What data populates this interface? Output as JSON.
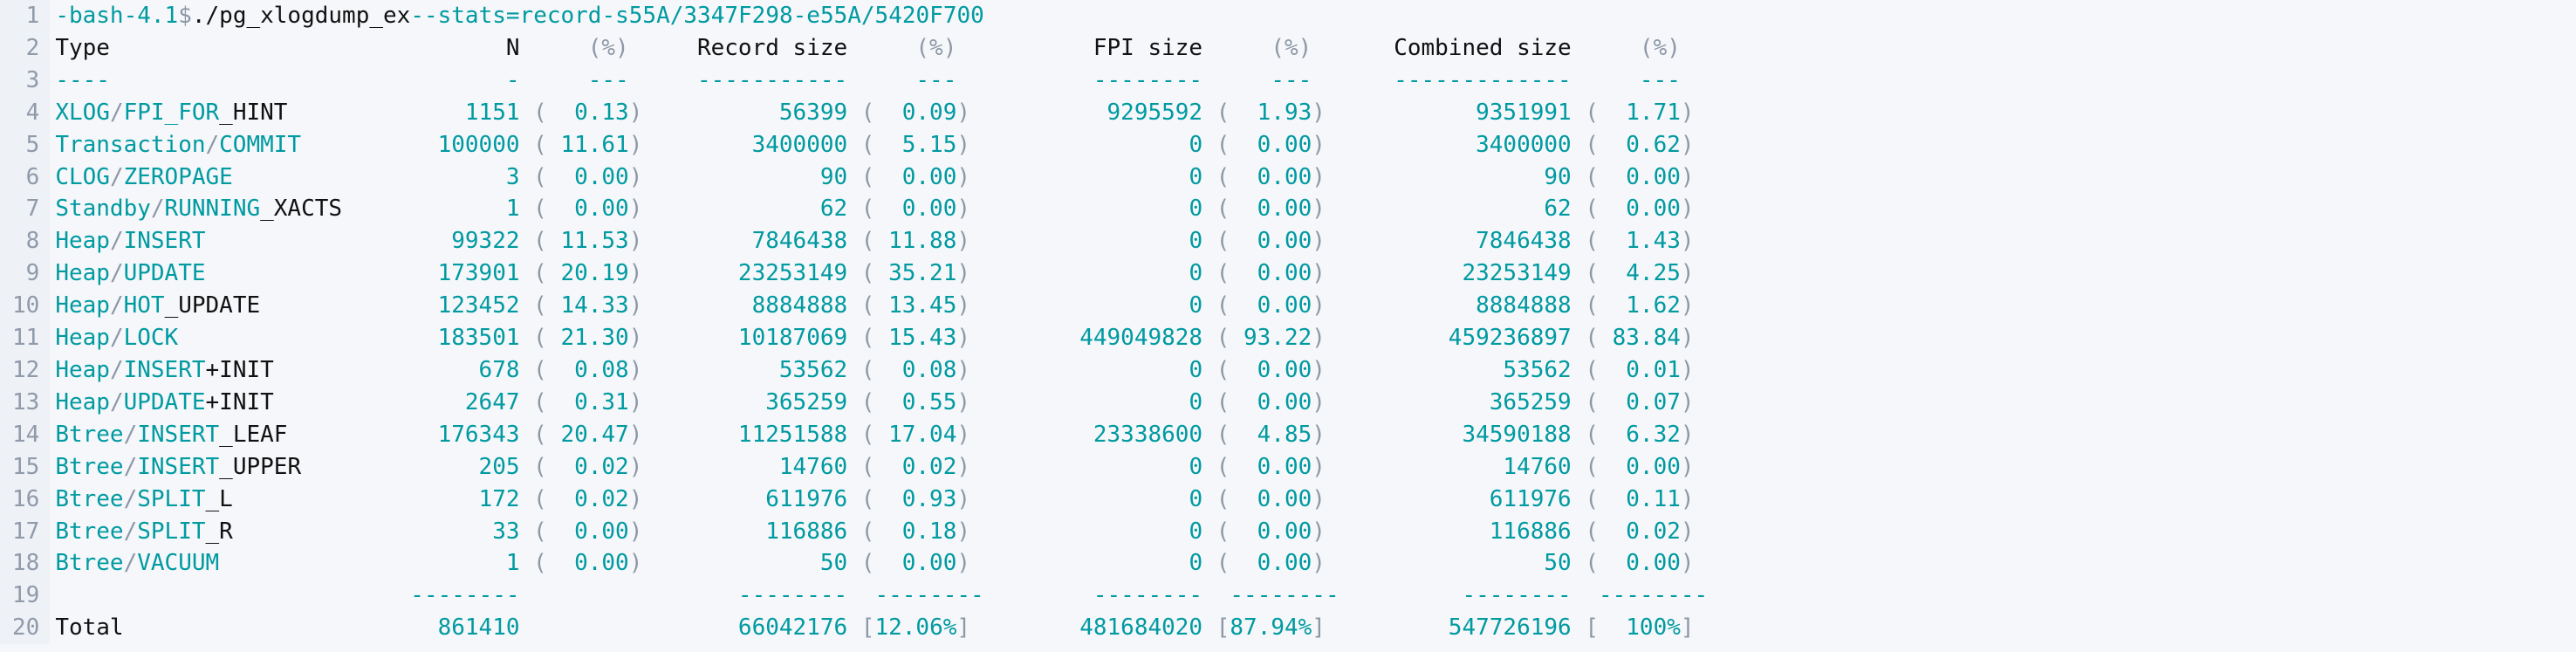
{
  "prompt": {
    "pre": "-bash-4.1",
    "dollar": "$ ",
    "cmd": "./pg_xlogdump_ex",
    "argStats": " --stats=record",
    "flagS": " -s ",
    "valS": "55A/3347F298",
    "flagE": " -e ",
    "valE": "55A/5420F700"
  },
  "head": {
    "type": "Type",
    "n": "N",
    "pct": "(%)",
    "rs": "Record size",
    "fs": "FPI size",
    "cs": "Combined size"
  },
  "dash": {
    "type": "----",
    "n": "        -",
    "pct": "---",
    "rs": "-----------",
    "fs": "--------",
    "cs": "-------------"
  },
  "rows": [
    {
      "t1": "XLOG",
      "sep": "/",
      "t2": "FPI_FOR",
      "t3": "_HINT",
      "n": "1151",
      "p": "0.13",
      "rs": "56399",
      "rp": "0.09",
      "fs": "9295592",
      "fp": "1.93",
      "cs": "9351991",
      "cp": "1.71"
    },
    {
      "t1": "Transaction",
      "sep": "/",
      "t2": "COMMIT",
      "t3": "",
      "n": "100000",
      "p": "11.61",
      "rs": "3400000",
      "rp": "5.15",
      "fs": "0",
      "fp": "0.00",
      "cs": "3400000",
      "cp": "0.62"
    },
    {
      "t1": "CLOG",
      "sep": "/",
      "t2": "ZEROPAGE",
      "t3": "",
      "n": "3",
      "p": "0.00",
      "rs": "90",
      "rp": "0.00",
      "fs": "0",
      "fp": "0.00",
      "cs": "90",
      "cp": "0.00"
    },
    {
      "t1": "Standby",
      "sep": "/",
      "t2": "RUNNING",
      "t3": "_XACTS",
      "n": "1",
      "p": "0.00",
      "rs": "62",
      "rp": "0.00",
      "fs": "0",
      "fp": "0.00",
      "cs": "62",
      "cp": "0.00"
    },
    {
      "t1": "Heap",
      "sep": "/",
      "t2": "INSERT",
      "t3": "",
      "n": "99322",
      "p": "11.53",
      "rs": "7846438",
      "rp": "11.88",
      "fs": "0",
      "fp": "0.00",
      "cs": "7846438",
      "cp": "1.43"
    },
    {
      "t1": "Heap",
      "sep": "/",
      "t2": "UPDATE",
      "t3": "",
      "n": "173901",
      "p": "20.19",
      "rs": "23253149",
      "rp": "35.21",
      "fs": "0",
      "fp": "0.00",
      "cs": "23253149",
      "cp": "4.25"
    },
    {
      "t1": "Heap",
      "sep": "/",
      "t2": "HOT",
      "t3": "_UPDATE",
      "n": "123452",
      "p": "14.33",
      "rs": "8884888",
      "rp": "13.45",
      "fs": "0",
      "fp": "0.00",
      "cs": "8884888",
      "cp": "1.62"
    },
    {
      "t1": "Heap",
      "sep": "/",
      "t2": "LOCK",
      "t3": "",
      "n": "183501",
      "p": "21.30",
      "rs": "10187069",
      "rp": "15.43",
      "fs": "449049828",
      "fp": "93.22",
      "cs": "459236897",
      "cp": "83.84"
    },
    {
      "t1": "Heap",
      "sep": "/",
      "t2": "INSERT",
      "t3": "+INIT",
      "n": "678",
      "p": "0.08",
      "rs": "53562",
      "rp": "0.08",
      "fs": "0",
      "fp": "0.00",
      "cs": "53562",
      "cp": "0.01"
    },
    {
      "t1": "Heap",
      "sep": "/",
      "t2": "UPDATE",
      "t3": "+INIT",
      "n": "2647",
      "p": "0.31",
      "rs": "365259",
      "rp": "0.55",
      "fs": "0",
      "fp": "0.00",
      "cs": "365259",
      "cp": "0.07"
    },
    {
      "t1": "Btree",
      "sep": "/",
      "t2": "INSERT",
      "t3": "_LEAF",
      "n": "176343",
      "p": "20.47",
      "rs": "11251588",
      "rp": "17.04",
      "fs": "23338600",
      "fp": "4.85",
      "cs": "34590188",
      "cp": "6.32"
    },
    {
      "t1": "Btree",
      "sep": "/",
      "t2": "INSERT",
      "t3": "_UPPER",
      "n": "205",
      "p": "0.02",
      "rs": "14760",
      "rp": "0.02",
      "fs": "0",
      "fp": "0.00",
      "cs": "14760",
      "cp": "0.00"
    },
    {
      "t1": "Btree",
      "sep": "/",
      "t2": "SPLIT",
      "t3": "_L",
      "n": "172",
      "p": "0.02",
      "rs": "611976",
      "rp": "0.93",
      "fs": "0",
      "fp": "0.00",
      "cs": "611976",
      "cp": "0.11"
    },
    {
      "t1": "Btree",
      "sep": "/",
      "t2": "SPLIT",
      "t3": "_R",
      "n": "33",
      "p": "0.00",
      "rs": "116886",
      "rp": "0.18",
      "fs": "0",
      "fp": "0.00",
      "cs": "116886",
      "cp": "0.02"
    },
    {
      "t1": "Btree",
      "sep": "/",
      "t2": "VACUUM",
      "t3": "",
      "n": "1",
      "p": "0.00",
      "rs": "50",
      "rp": "0.00",
      "fs": "0",
      "fp": "0.00",
      "cs": "50",
      "cp": "0.00"
    }
  ],
  "sep": "--------",
  "total": {
    "label": "Total",
    "n": "861410",
    "rs": "66042176",
    "rp": "12.06%",
    "fs": "481684020",
    "fp": "87.94%",
    "cs": "547726196",
    "cp": "100%"
  }
}
